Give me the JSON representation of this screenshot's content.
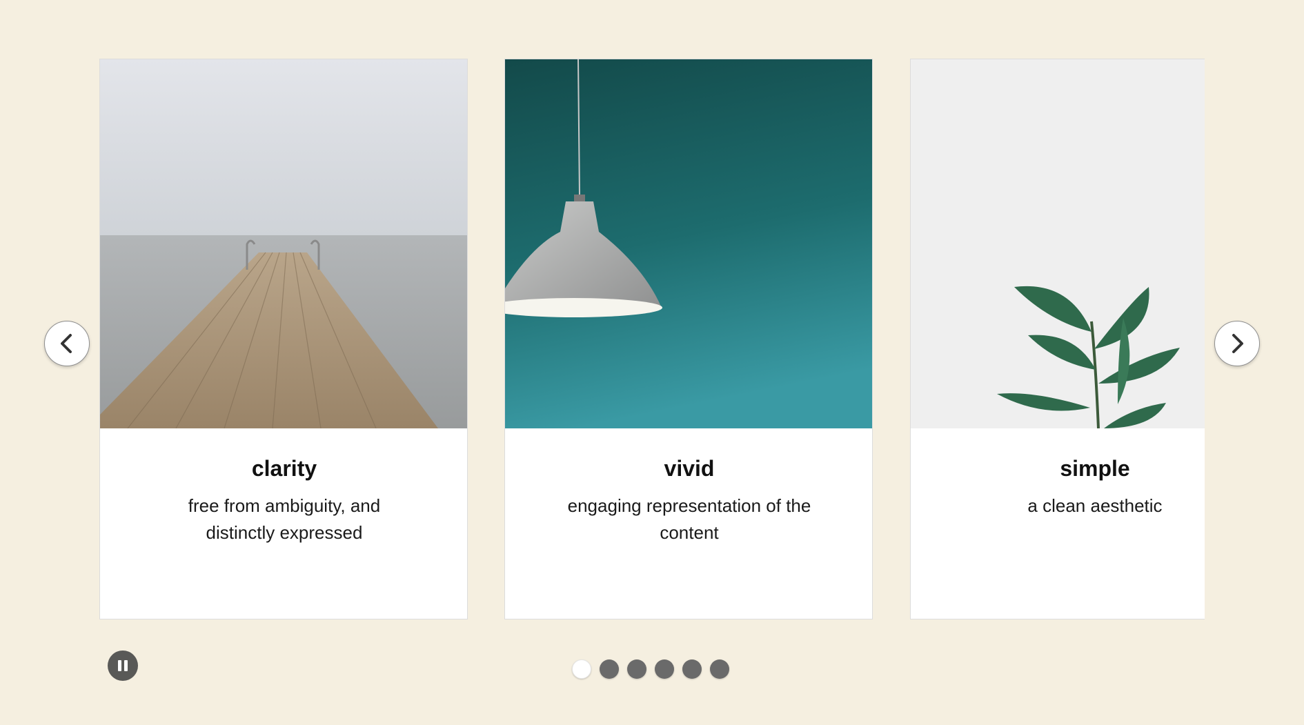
{
  "carousel": {
    "cards": [
      {
        "title": "clarity",
        "description": "free from ambiguity, and distinctly expressed",
        "image": "pier-photo"
      },
      {
        "title": "vivid",
        "description": "engaging representation of the content",
        "image": "pendant-lamp-photo"
      },
      {
        "title": "simple",
        "description": "a clean aesthetic",
        "image": "plant-photo"
      }
    ],
    "prev_icon": "chevron-left-icon",
    "next_icon": "chevron-right-icon",
    "pause_icon": "pause-icon",
    "total_slides": 6,
    "active_slide": 1
  },
  "colors": {
    "background": "#f5efe0",
    "card": "#ffffff",
    "dot_inactive": "#6a6a6a",
    "dot_active": "#ffffff",
    "pause_button": "#595957"
  }
}
